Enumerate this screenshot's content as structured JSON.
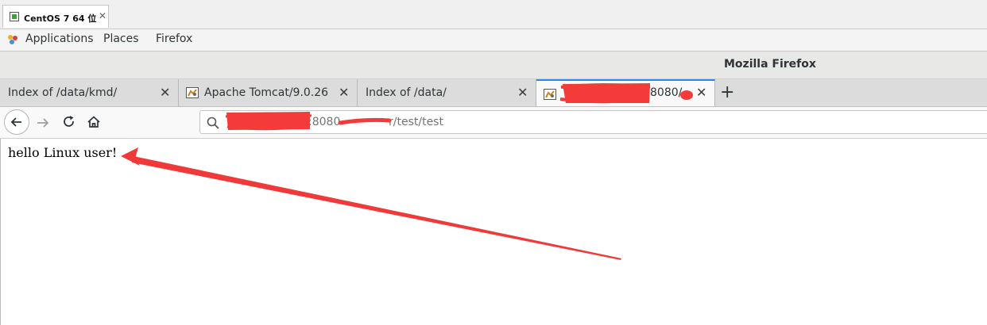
{
  "vm": {
    "tab_title": "CentOS 7 64 位",
    "close_glyph": "✕"
  },
  "gnome": {
    "menus": [
      "Applications",
      "Places",
      "Firefox"
    ]
  },
  "window": {
    "title": "Mozilla Firefox"
  },
  "tabs": [
    {
      "label": "Index of /data/kmd/",
      "has_favicon": false,
      "active": false
    },
    {
      "label": "Apache Tomcat/9.0.26",
      "has_favicon": true,
      "active": false
    },
    {
      "label": "Index of /data/",
      "has_favicon": false,
      "active": false
    },
    {
      "label": "8080/",
      "has_favicon": true,
      "active": true,
      "redacted": true
    }
  ],
  "tab_close_glyph": "✕",
  "new_tab_glyph": "+",
  "nav": {
    "url_visible_port": ":8080",
    "url_visible_path": "r/test/test",
    "url_redacted": true
  },
  "page": {
    "body_text": "hello Linux user!"
  },
  "annotation": {
    "color": "#f03a3a",
    "kind": "red-arrow-pointing-to-text",
    "redaction_color": "#f53a3a"
  }
}
